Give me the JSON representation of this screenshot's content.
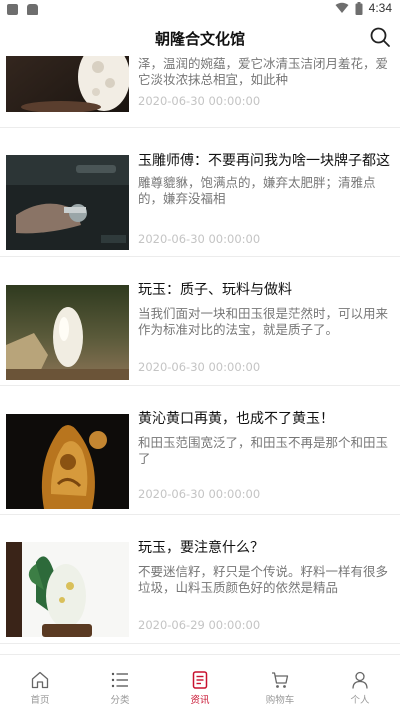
{
  "status_bar": {
    "time": "4:34"
  },
  "header": {
    "title": "朝隆合文化馆"
  },
  "articles": [
    {
      "title": "",
      "description": "我们爱和田玉，爱它斑斓的皮色，宝润的光泽，温润的婉蕴，爱它冰清玉洁闭月羞花，爱它淡妆浓抹总相宜，如此种",
      "date": "2020-06-30 00:00:00"
    },
    {
      "title": "玉雕师傅：不要再问我为啥一块牌子都这么贵",
      "description": "雕尊貔貅，饱满点的，嫌弃太肥胖；清雅点的，嫌弃没福相",
      "date": "2020-06-30 00:00:00"
    },
    {
      "title": "玩玉：质子、玩料与做料",
      "description": "当我们面对一块和田玉很是茫然时，可以用来作为标准对比的法宝，就是质子了。",
      "date": "2020-06-30 00:00:00"
    },
    {
      "title": "黄沁黄口再黄，也成不了黄玉！",
      "description": "和田玉范围宽泛了，和田玉不再是那个和田玉了",
      "date": "2020-06-30 00:00:00"
    },
    {
      "title": "玩玉，要注意什么？",
      "description": "不要迷信籽，籽只是个传说。籽料一样有很多垃圾，山料玉质颜色好的依然是精品",
      "date": "2020-06-29 00:00:00"
    }
  ],
  "tab_bar": {
    "tabs": [
      {
        "label": "首页",
        "icon": "home-icon",
        "active": false
      },
      {
        "label": "分类",
        "icon": "list-icon",
        "active": false
      },
      {
        "label": "资讯",
        "icon": "news-icon",
        "active": true
      },
      {
        "label": "购物车",
        "icon": "cart-icon",
        "active": false
      },
      {
        "label": "个人",
        "icon": "person-icon",
        "active": false
      }
    ]
  },
  "colors": {
    "accent": "#c8102e",
    "date_text": "#c4c4c4",
    "divider": "#ececec"
  }
}
